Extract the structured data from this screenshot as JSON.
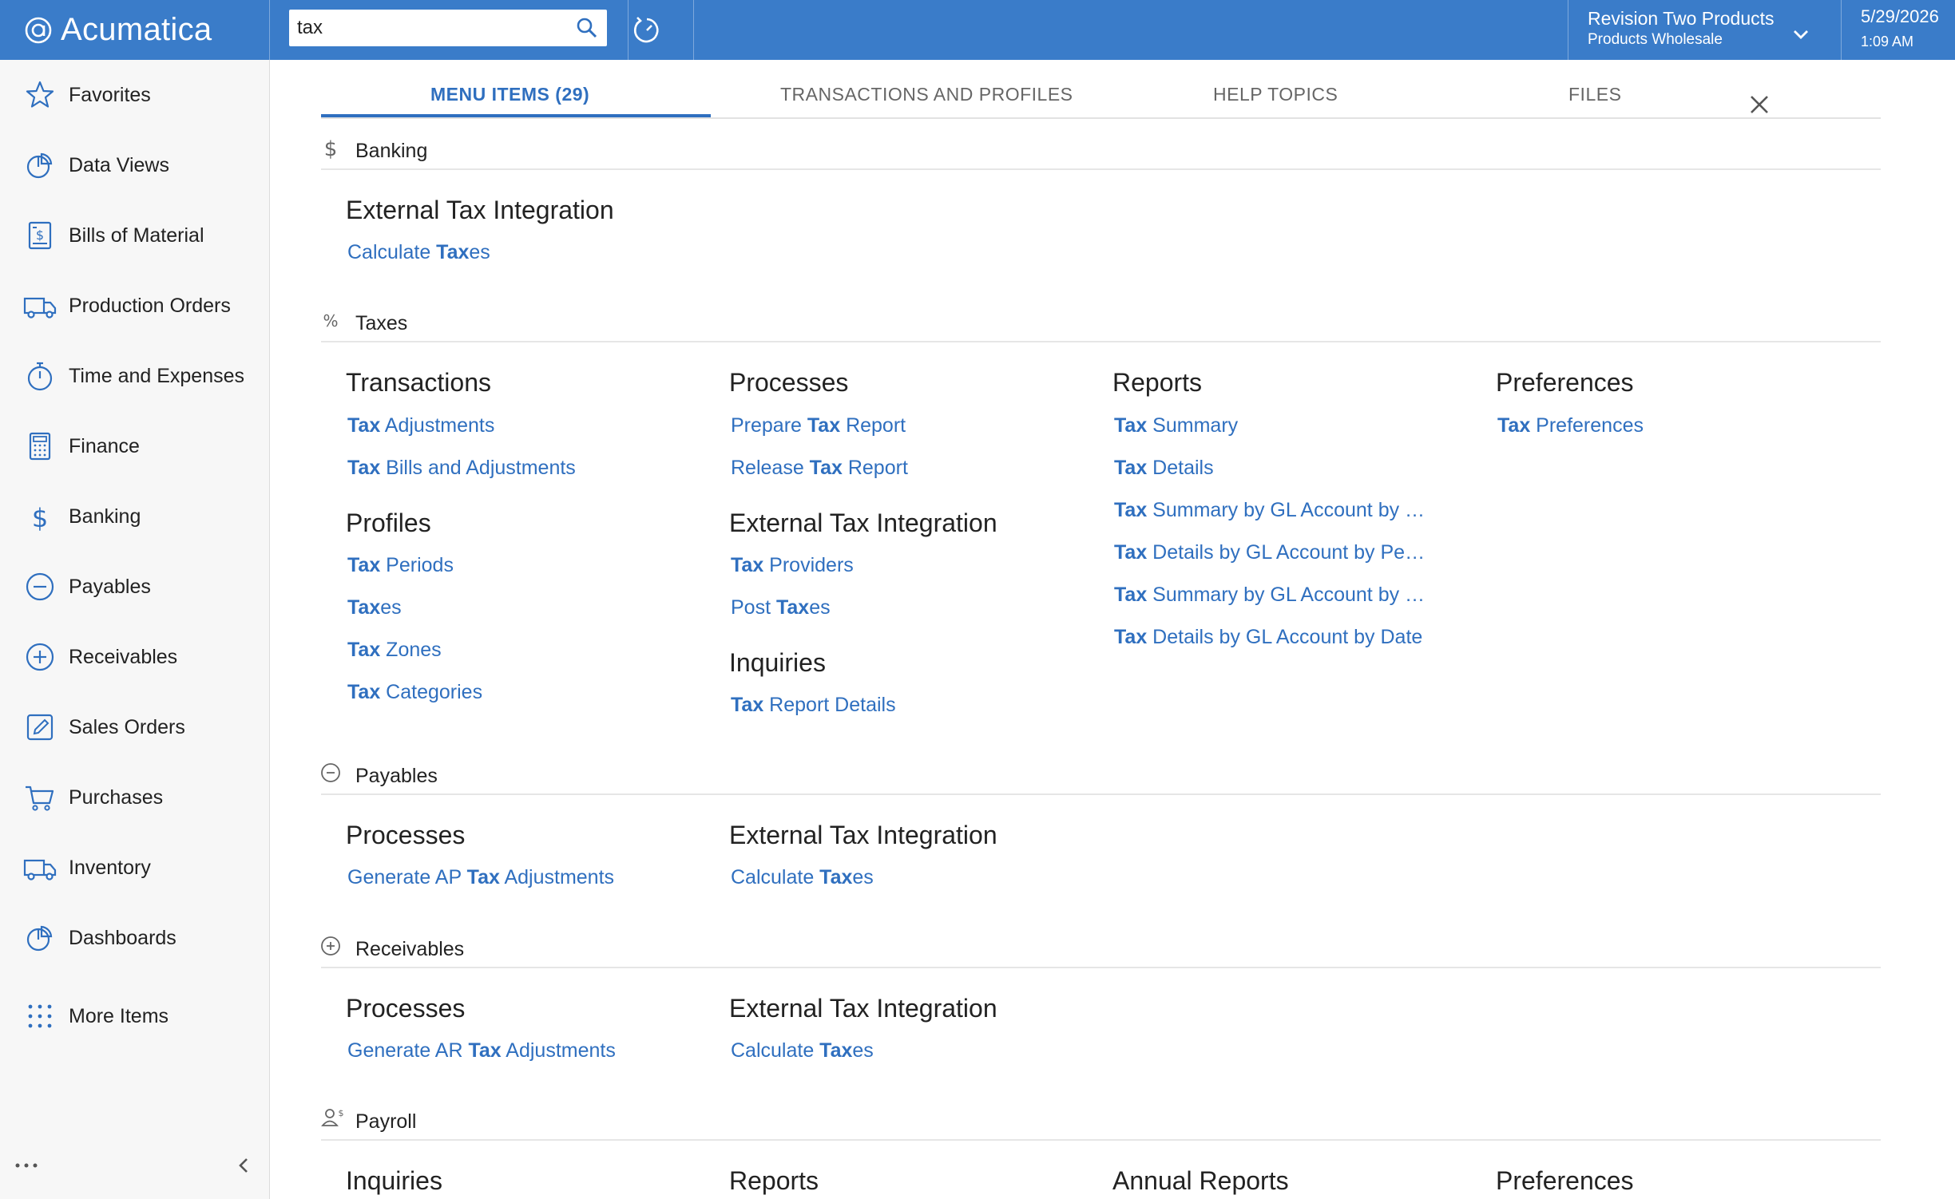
{
  "topbar": {
    "brand": "Acumatica",
    "search_value": "tax",
    "company_name": "Revision Two Products",
    "company_branch": "Products Wholesale",
    "date": "5/29/2026",
    "time": "1:09 AM",
    "color": "#3a7cc9"
  },
  "sidebar": {
    "items": [
      {
        "label": "Favorites",
        "icon": "star-icon"
      },
      {
        "label": "Data Views",
        "icon": "pie-chart-icon"
      },
      {
        "label": "Bills of Material",
        "icon": "document-dollar-icon"
      },
      {
        "label": "Production Orders",
        "icon": "truck-icon"
      },
      {
        "label": "Time and Expenses",
        "icon": "stopwatch-icon"
      },
      {
        "label": "Finance",
        "icon": "calculator-icon"
      },
      {
        "label": "Banking",
        "icon": "dollar-icon"
      },
      {
        "label": "Payables",
        "icon": "minus-circle-icon"
      },
      {
        "label": "Receivables",
        "icon": "plus-circle-icon"
      },
      {
        "label": "Sales Orders",
        "icon": "edit-icon"
      },
      {
        "label": "Purchases",
        "icon": "cart-icon"
      },
      {
        "label": "Inventory",
        "icon": "truck-icon"
      },
      {
        "label": "Dashboards",
        "icon": "pie-chart-icon"
      },
      {
        "label": "More Items",
        "icon": "grid-dots-icon"
      }
    ]
  },
  "tabs": {
    "menu_items": "MENU ITEMS  (29)",
    "transactions": "TRANSACTIONS AND PROFILES",
    "help": "HELP TOPICS",
    "files": "FILES"
  },
  "sections": {
    "banking": {
      "title": "Banking",
      "ext_title": "External Tax Integration",
      "ext_link": {
        "pre": "Calculate ",
        "bold": "Tax",
        "post": "es"
      }
    },
    "taxes": {
      "title": "Taxes",
      "transactions_title": "Transactions",
      "transactions": [
        {
          "bold": "Tax",
          "post": " Adjustments"
        },
        {
          "bold": "Tax",
          "post": " Bills and Adjustments"
        }
      ],
      "profiles_title": "Profiles",
      "profiles": [
        {
          "bold": "Tax",
          "post": " Periods"
        },
        {
          "bold": "Tax",
          "post": "es"
        },
        {
          "bold": "Tax",
          "post": " Zones"
        },
        {
          "bold": "Tax",
          "post": " Categories"
        }
      ],
      "processes_title": "Processes",
      "processes": [
        {
          "pre": "Prepare ",
          "bold": "Tax",
          "post": " Report"
        },
        {
          "pre": "Release ",
          "bold": "Tax",
          "post": " Report"
        }
      ],
      "ext_title": "External Tax Integration",
      "ext": [
        {
          "bold": "Tax",
          "post": " Providers"
        },
        {
          "pre": "Post ",
          "bold": "Tax",
          "post": "es"
        }
      ],
      "inquiries_title": "Inquiries",
      "inquiries": [
        {
          "bold": "Tax",
          "post": " Report Details"
        }
      ],
      "reports_title": "Reports",
      "reports": [
        {
          "bold": "Tax",
          "post": " Summary"
        },
        {
          "bold": "Tax",
          "post": " Details"
        },
        {
          "bold": "Tax",
          "post": " Summary by GL Account by …"
        },
        {
          "bold": "Tax",
          "post": " Details by GL Account by Pe…"
        },
        {
          "bold": "Tax",
          "post": " Summary by GL Account by …"
        },
        {
          "bold": "Tax",
          "post": " Details by GL Account by Date"
        }
      ],
      "preferences_title": "Preferences",
      "preferences": [
        {
          "bold": "Tax",
          "post": " Preferences"
        }
      ]
    },
    "payables": {
      "title": "Payables",
      "processes_title": "Processes",
      "process_link": {
        "pre": "Generate AP ",
        "bold": "Tax",
        "post": " Adjustments"
      },
      "ext_title": "External Tax Integration",
      "ext_link": {
        "pre": "Calculate ",
        "bold": "Tax",
        "post": "es"
      }
    },
    "receivables": {
      "title": "Receivables",
      "processes_title": "Processes",
      "process_link": {
        "pre": "Generate AR ",
        "bold": "Tax",
        "post": " Adjustments"
      },
      "ext_title": "External Tax Integration",
      "ext_link": {
        "pre": "Calculate ",
        "bold": "Tax",
        "post": "es"
      }
    },
    "payroll": {
      "title": "Payroll",
      "col1": "Inquiries",
      "col2": "Reports",
      "col3": "Annual Reports",
      "col4": "Preferences"
    }
  },
  "colors": {
    "link": "#2f6fbf",
    "sidebar_bg": "#f7f7f7"
  }
}
